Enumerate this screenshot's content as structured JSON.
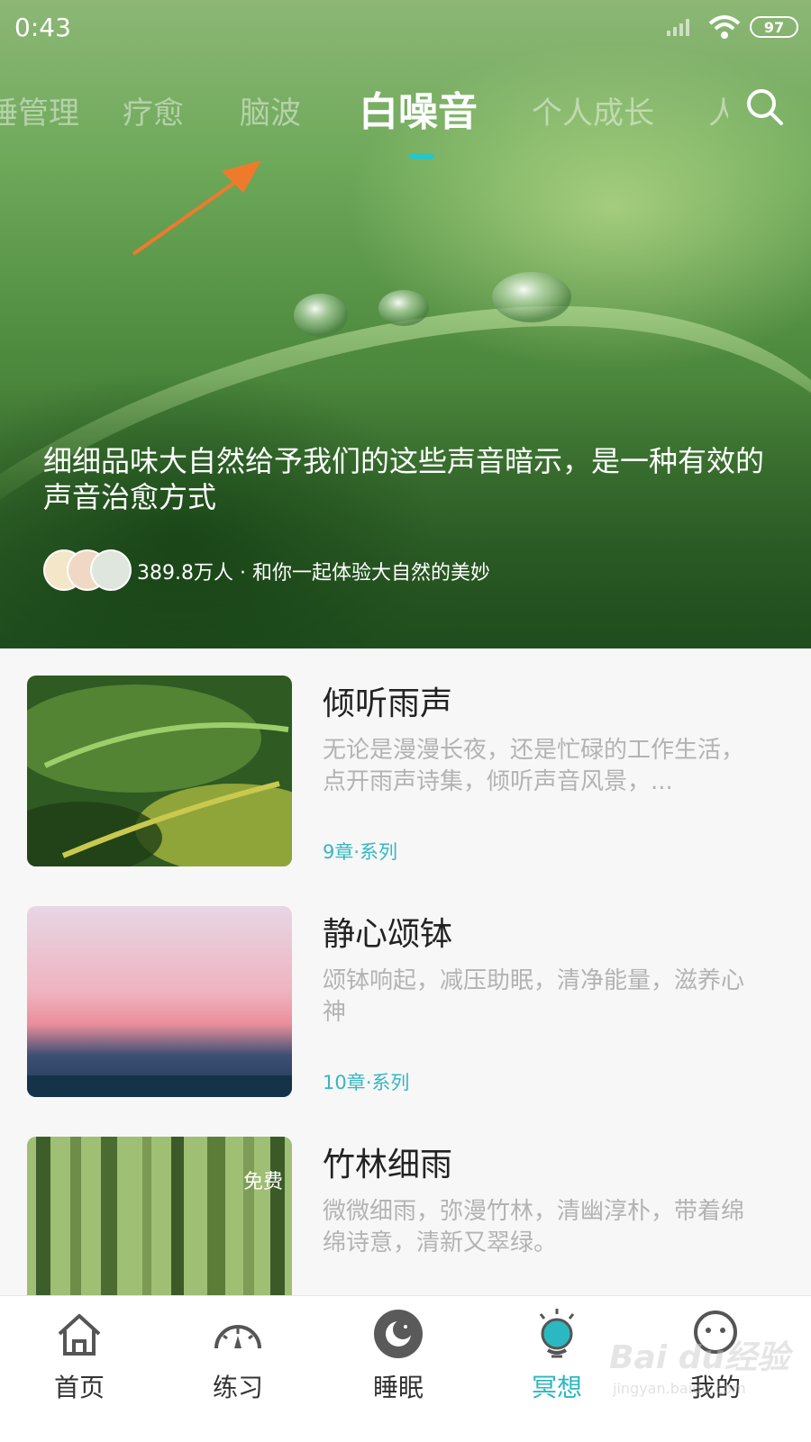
{
  "status_bar": {
    "time": "0:43",
    "battery": "97"
  },
  "tabs": [
    {
      "label": "睡管理",
      "active": false
    },
    {
      "label": "疗愈",
      "active": false
    },
    {
      "label": "脑波",
      "active": false
    },
    {
      "label": "白噪音",
      "active": true
    },
    {
      "label": "个人成长",
      "active": false
    },
    {
      "label": "人",
      "active": false
    }
  ],
  "hero": {
    "description": "细细品味大自然给予我们的这些声音暗示，是一种有效的声音治愈方式",
    "participants": "389.8万人 · 和你一起体验大自然的美妙"
  },
  "list": [
    {
      "title": "倾听雨声",
      "description": "无论是漫漫长夜，还是忙碌的工作生活，点开雨声诗集，倾听声音风景，...",
      "meta": "9章·系列",
      "badge": ""
    },
    {
      "title": "静心颂钵",
      "description": "颂钵响起，减压助眠，清净能量，滋养心神",
      "meta": "10章·系列",
      "badge": ""
    },
    {
      "title": "竹林细雨",
      "description": "微微细雨，弥漫竹林，清幽淳朴，带着绵绵诗意，清新又翠绿。",
      "meta": "",
      "badge": "免费"
    }
  ],
  "nav": [
    {
      "label": "首页",
      "icon": "home-icon",
      "active": false
    },
    {
      "label": "练习",
      "icon": "gauge-icon",
      "active": false
    },
    {
      "label": "睡眠",
      "icon": "moon-icon",
      "active": false
    },
    {
      "label": "冥想",
      "icon": "bulb-icon",
      "active": true
    },
    {
      "label": "我的",
      "icon": "face-icon",
      "active": false
    }
  ],
  "colors": {
    "accent": "#2bb8c0",
    "indicator": "#2cc3c3",
    "arrow": "#f07a2c"
  },
  "watermark": {
    "brand": "Bai du经验",
    "url": "jingyan.baidu.com"
  }
}
